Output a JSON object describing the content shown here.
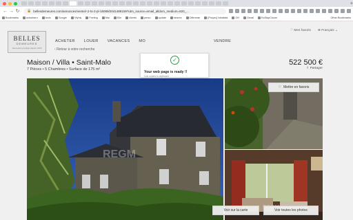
{
  "browser": {
    "url": "bellesdemeures.com/annonces/vente/r-2-ts-2-pl-16089/2041489159?utm_source=email_alldom_medium=820_..."
  },
  "bookmarks": [
    "Bookmarks",
    "octosharo",
    "tools",
    "Google",
    "Vtyhly",
    "Feeling",
    "Mal",
    "Elle",
    "clients",
    "perso",
    "update",
    "strsres",
    "Offerman",
    "[Proyec] Idealista",
    "OH",
    "Gmail",
    "EsStayCloom"
  ],
  "bookmarks_other": "Other Bookmarks",
  "site": {
    "logo_main": "BELLES",
    "logo_sub": "DEMEURES",
    "logo_tag": "Demeures prestige depuis 1979"
  },
  "nav": [
    "ACHETER",
    "LOUER",
    "VACANCES",
    "MO",
    "",
    "",
    "VENDRE"
  ],
  "topright": {
    "favorites": "Mes favoris",
    "language": "Français"
  },
  "back_label": "Retour à votre recherche",
  "listing": {
    "title": "Maison / Villa • Saint-Malo",
    "subtitle": "7 Pièces • 5 Chambres • Surface de 175 m²",
    "price": "522 500 €",
    "share": "Partager"
  },
  "buttons": {
    "favorite": "Mettre en favoris",
    "map": "Voir sur la carte",
    "photos": "Voir toutes les photos"
  },
  "toast": {
    "title": "Your web page is ready !!",
    "sub": "Link copied to clipboard"
  },
  "watermark": "REGM",
  "colors": {
    "sky": "#1f4a9c",
    "accent_green": "#2e9a47"
  }
}
